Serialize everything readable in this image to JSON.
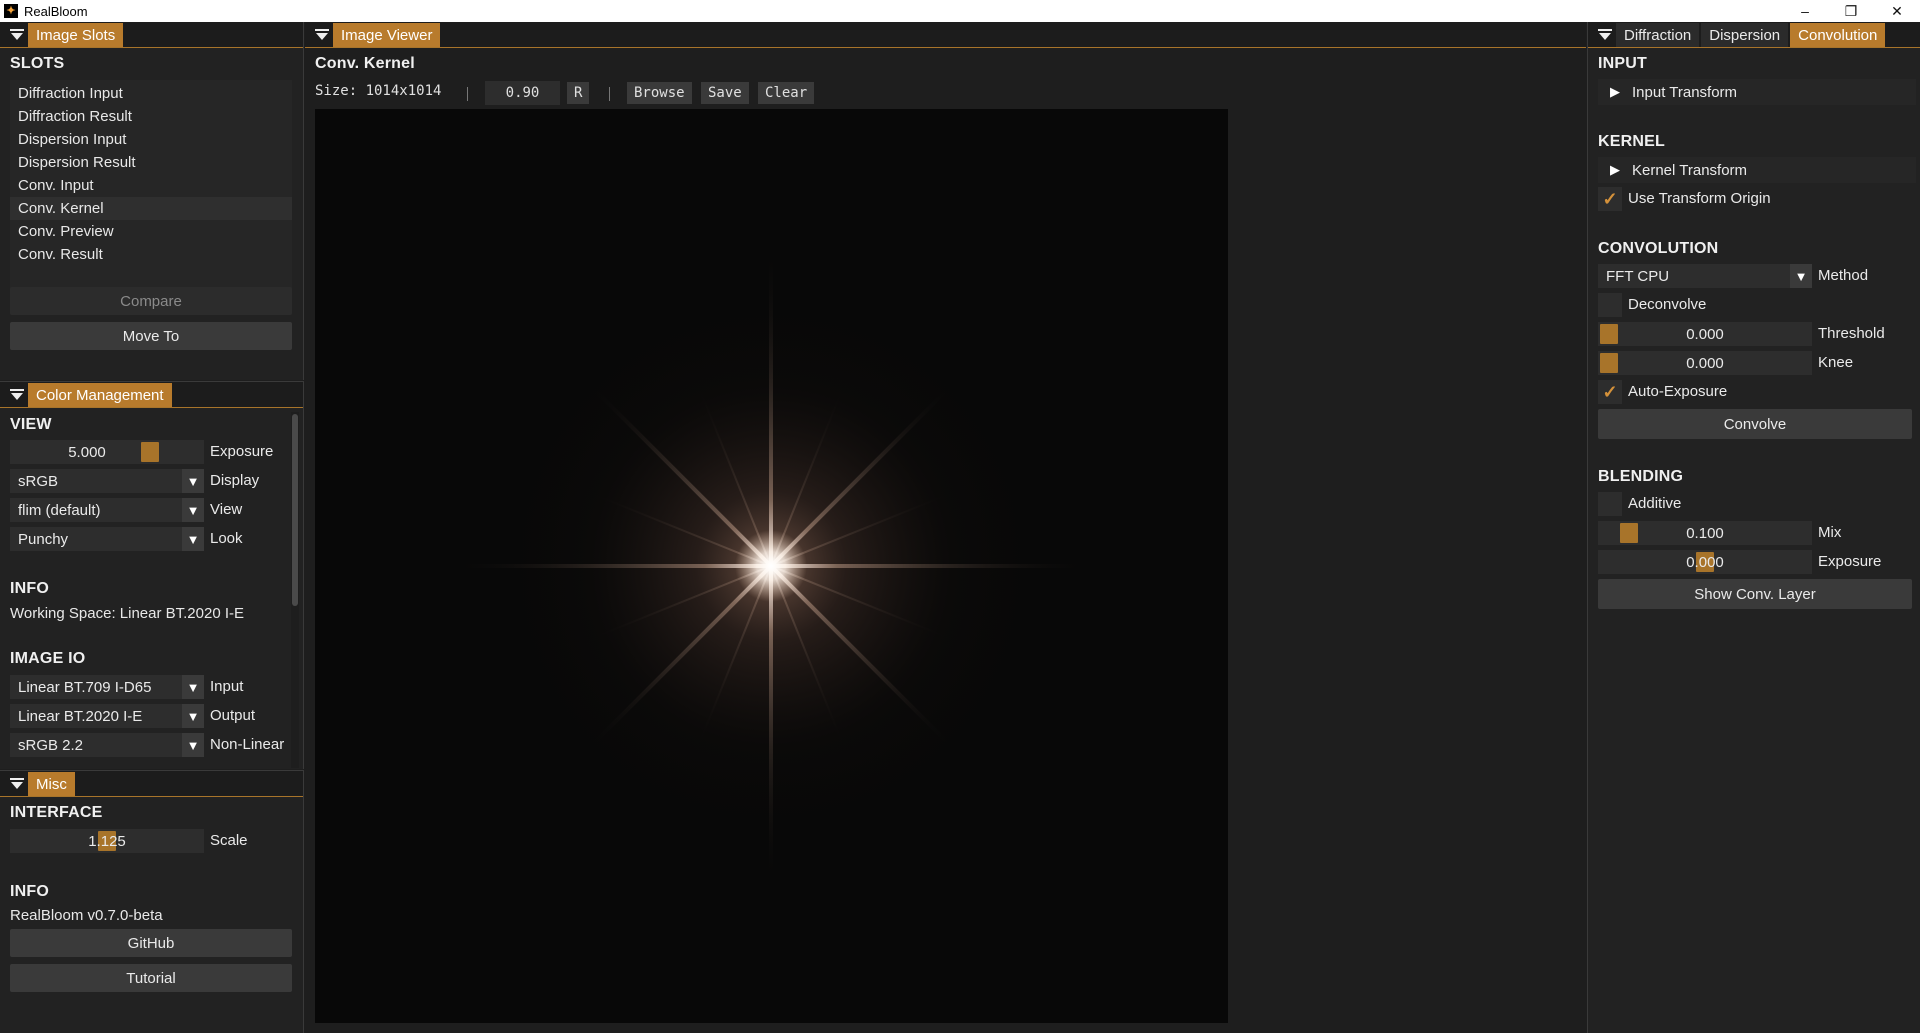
{
  "window": {
    "title": "RealBloom",
    "icon": "app-logo-icon",
    "controls": {
      "minimize": "–",
      "maximize": "❐",
      "close": "✕"
    }
  },
  "left_panel": {
    "image_slots": {
      "tab_label": "Image Slots",
      "section_title": "SLOTS",
      "slots": [
        "Diffraction Input",
        "Diffraction Result",
        "Dispersion Input",
        "Dispersion Result",
        "Conv. Input",
        "Conv. Kernel",
        "Conv. Preview",
        "Conv. Result"
      ],
      "selected_index": 5,
      "compare_label": "Compare",
      "move_to_label": "Move To"
    },
    "color_management": {
      "tab_label": "Color Management",
      "view_title": "VIEW",
      "exposure_value": "5.000",
      "exposure_label": "Exposure",
      "display_value": "sRGB",
      "display_label": "Display",
      "view_value": "flim (default)",
      "view_label": "View",
      "look_value": "Punchy",
      "look_label": "Look",
      "info_title": "INFO",
      "working_space": "Working Space: Linear BT.2020 I-E",
      "image_io_title": "IMAGE IO",
      "input_value": "Linear BT.709 I-D65",
      "input_label": "Input",
      "output_value": "Linear BT.2020 I-E",
      "output_label": "Output",
      "nonlinear_value": "sRGB 2.2",
      "nonlinear_label": "Non-Linear"
    },
    "misc": {
      "tab_label": "Misc",
      "interface_title": "INTERFACE",
      "scale_value": "1.125",
      "scale_label": "Scale",
      "info_title": "INFO",
      "version": "RealBloom v0.7.0-beta",
      "github_label": "GitHub",
      "tutorial_label": "Tutorial"
    }
  },
  "viewer": {
    "tab_label": "Image Viewer",
    "title": "Conv. Kernel",
    "size_text": "Size: 1014x1014",
    "zoom_value": "0.90",
    "reset_label": "R",
    "browse_label": "Browse",
    "save_label": "Save",
    "clear_label": "Clear"
  },
  "right_panel": {
    "tabs": [
      "Diffraction",
      "Dispersion",
      "Convolution"
    ],
    "active_tab": "Convolution",
    "input_title": "INPUT",
    "input_transform_label": "Input Transform",
    "kernel_title": "KERNEL",
    "kernel_transform_label": "Kernel Transform",
    "use_transform_origin_label": "Use Transform Origin",
    "use_transform_origin_checked": true,
    "convolution_title": "CONVOLUTION",
    "method_value": "FFT CPU",
    "method_label": "Method",
    "deconvolve_label": "Deconvolve",
    "deconvolve_checked": false,
    "threshold_value": "0.000",
    "threshold_label": "Threshold",
    "knee_value": "0.000",
    "knee_label": "Knee",
    "auto_exposure_label": "Auto-Exposure",
    "auto_exposure_checked": true,
    "convolve_label": "Convolve",
    "blending_title": "BLENDING",
    "additive_label": "Additive",
    "additive_checked": false,
    "mix_value": "0.100",
    "mix_label": "Mix",
    "exposure_value": "0.000",
    "exposure_label": "Exposure",
    "show_layer_label": "Show Conv. Layer"
  },
  "colors": {
    "accent": "#b87b2c",
    "panel_bg": "#222222",
    "widget_bg": "#2d2d2d",
    "button_bg": "#3a3a3a"
  }
}
